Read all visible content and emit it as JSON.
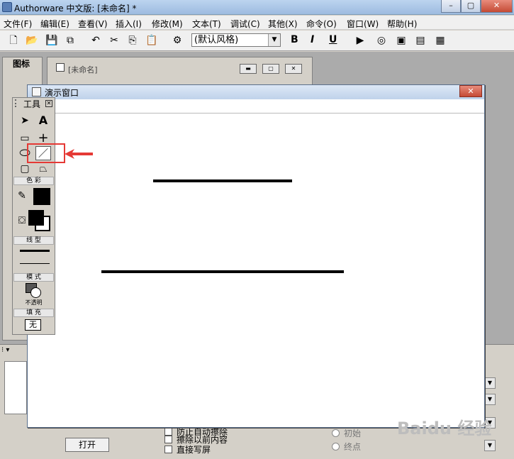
{
  "app": {
    "title": "Authorware 中文版: [未命名] *",
    "window_controls": [
      "–",
      "▢",
      "✕"
    ]
  },
  "menubar": {
    "items": [
      "文件(F)",
      "编辑(E)",
      "查看(V)",
      "插入(I)",
      "修改(M)",
      "文本(T)",
      "调试(C)",
      "其他(X)",
      "命令(O)",
      "窗口(W)",
      "帮助(H)"
    ]
  },
  "toolbar": {
    "style_value": "(默认风格)",
    "bold_label": "B",
    "italic_label": "I",
    "underline_label": "U"
  },
  "icon_palette": {
    "title": "图标"
  },
  "design_window": {
    "title": "[未命名]"
  },
  "presentation_window": {
    "title": "演示窗口",
    "close_label": "✕"
  },
  "tools": {
    "title": "工具",
    "color_label": "色 彩",
    "linetype_label": "线 型",
    "mode_label": "模 式",
    "mode_value": "不透明",
    "fill_label": "填 充",
    "fill_value": "无",
    "text_tool_label": "A"
  },
  "properties": {
    "open_button": "打开",
    "checkboxes": [
      "防止自动擦除",
      "擦除以前内容",
      "直接写屏"
    ],
    "radios": [
      "初始",
      "终点"
    ]
  },
  "watermark": {
    "text": "Baidu 经验"
  },
  "colors": {
    "highlight": "#e53935",
    "title_bar": "#bcd4ef"
  }
}
